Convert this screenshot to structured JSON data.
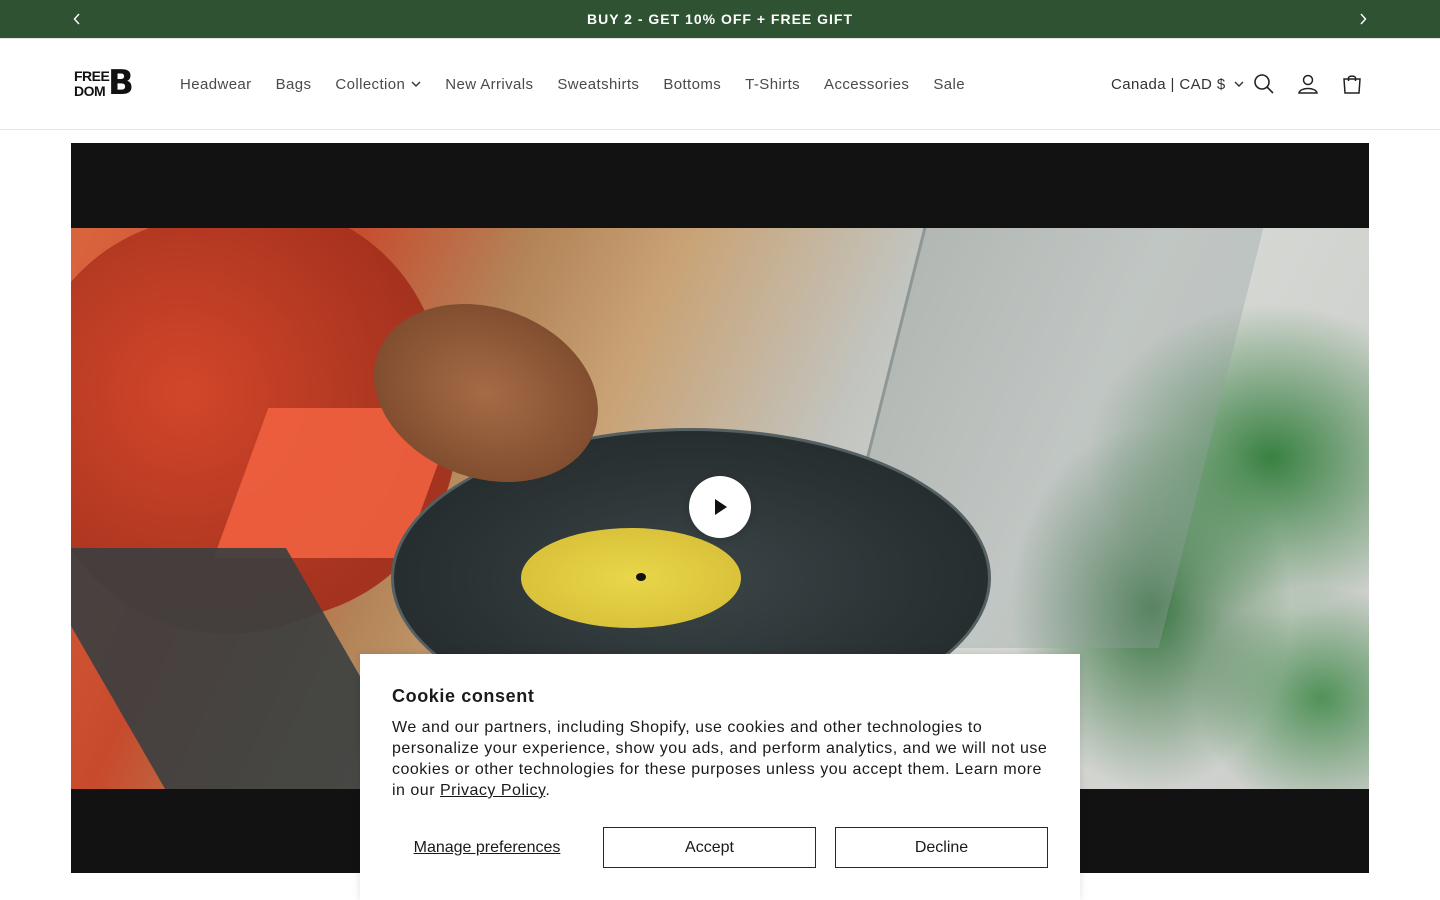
{
  "announcement": {
    "text": "BUY 2 - GET 10% OFF + FREE GIFT",
    "prev_icon": "chevron-left-icon",
    "next_icon": "chevron-right-icon"
  },
  "header": {
    "logo": {
      "line1": "FREE",
      "line2": "DOM",
      "mark": "B"
    },
    "nav": [
      {
        "label": "Headwear"
      },
      {
        "label": "Bags"
      },
      {
        "label": "Collection",
        "has_dropdown": true
      },
      {
        "label": "New Arrivals"
      },
      {
        "label": "Sweatshirts"
      },
      {
        "label": "Bottoms"
      },
      {
        "label": "T-Shirts"
      },
      {
        "label": "Accessories"
      },
      {
        "label": "Sale"
      }
    ],
    "country_selector": "Canada | CAD $",
    "icons": [
      "search-icon",
      "account-icon",
      "cart-icon"
    ]
  },
  "hero": {
    "media": "video",
    "play_icon": "play-icon"
  },
  "cookie": {
    "title": "Cookie consent",
    "body": "We and our partners, including Shopify, use cookies and other technologies to personalize your experience, show you ads, and perform analytics, and we will not use cookies or other technologies for these purposes unless you accept them. Learn more in our ",
    "link": "Privacy Policy",
    "link_suffix": ".",
    "manage_label": "Manage preferences",
    "accept_label": "Accept",
    "decline_label": "Decline"
  },
  "colors": {
    "announcement_bg": "#2f5233",
    "hero_bg": "#121212",
    "text": "#121212"
  }
}
